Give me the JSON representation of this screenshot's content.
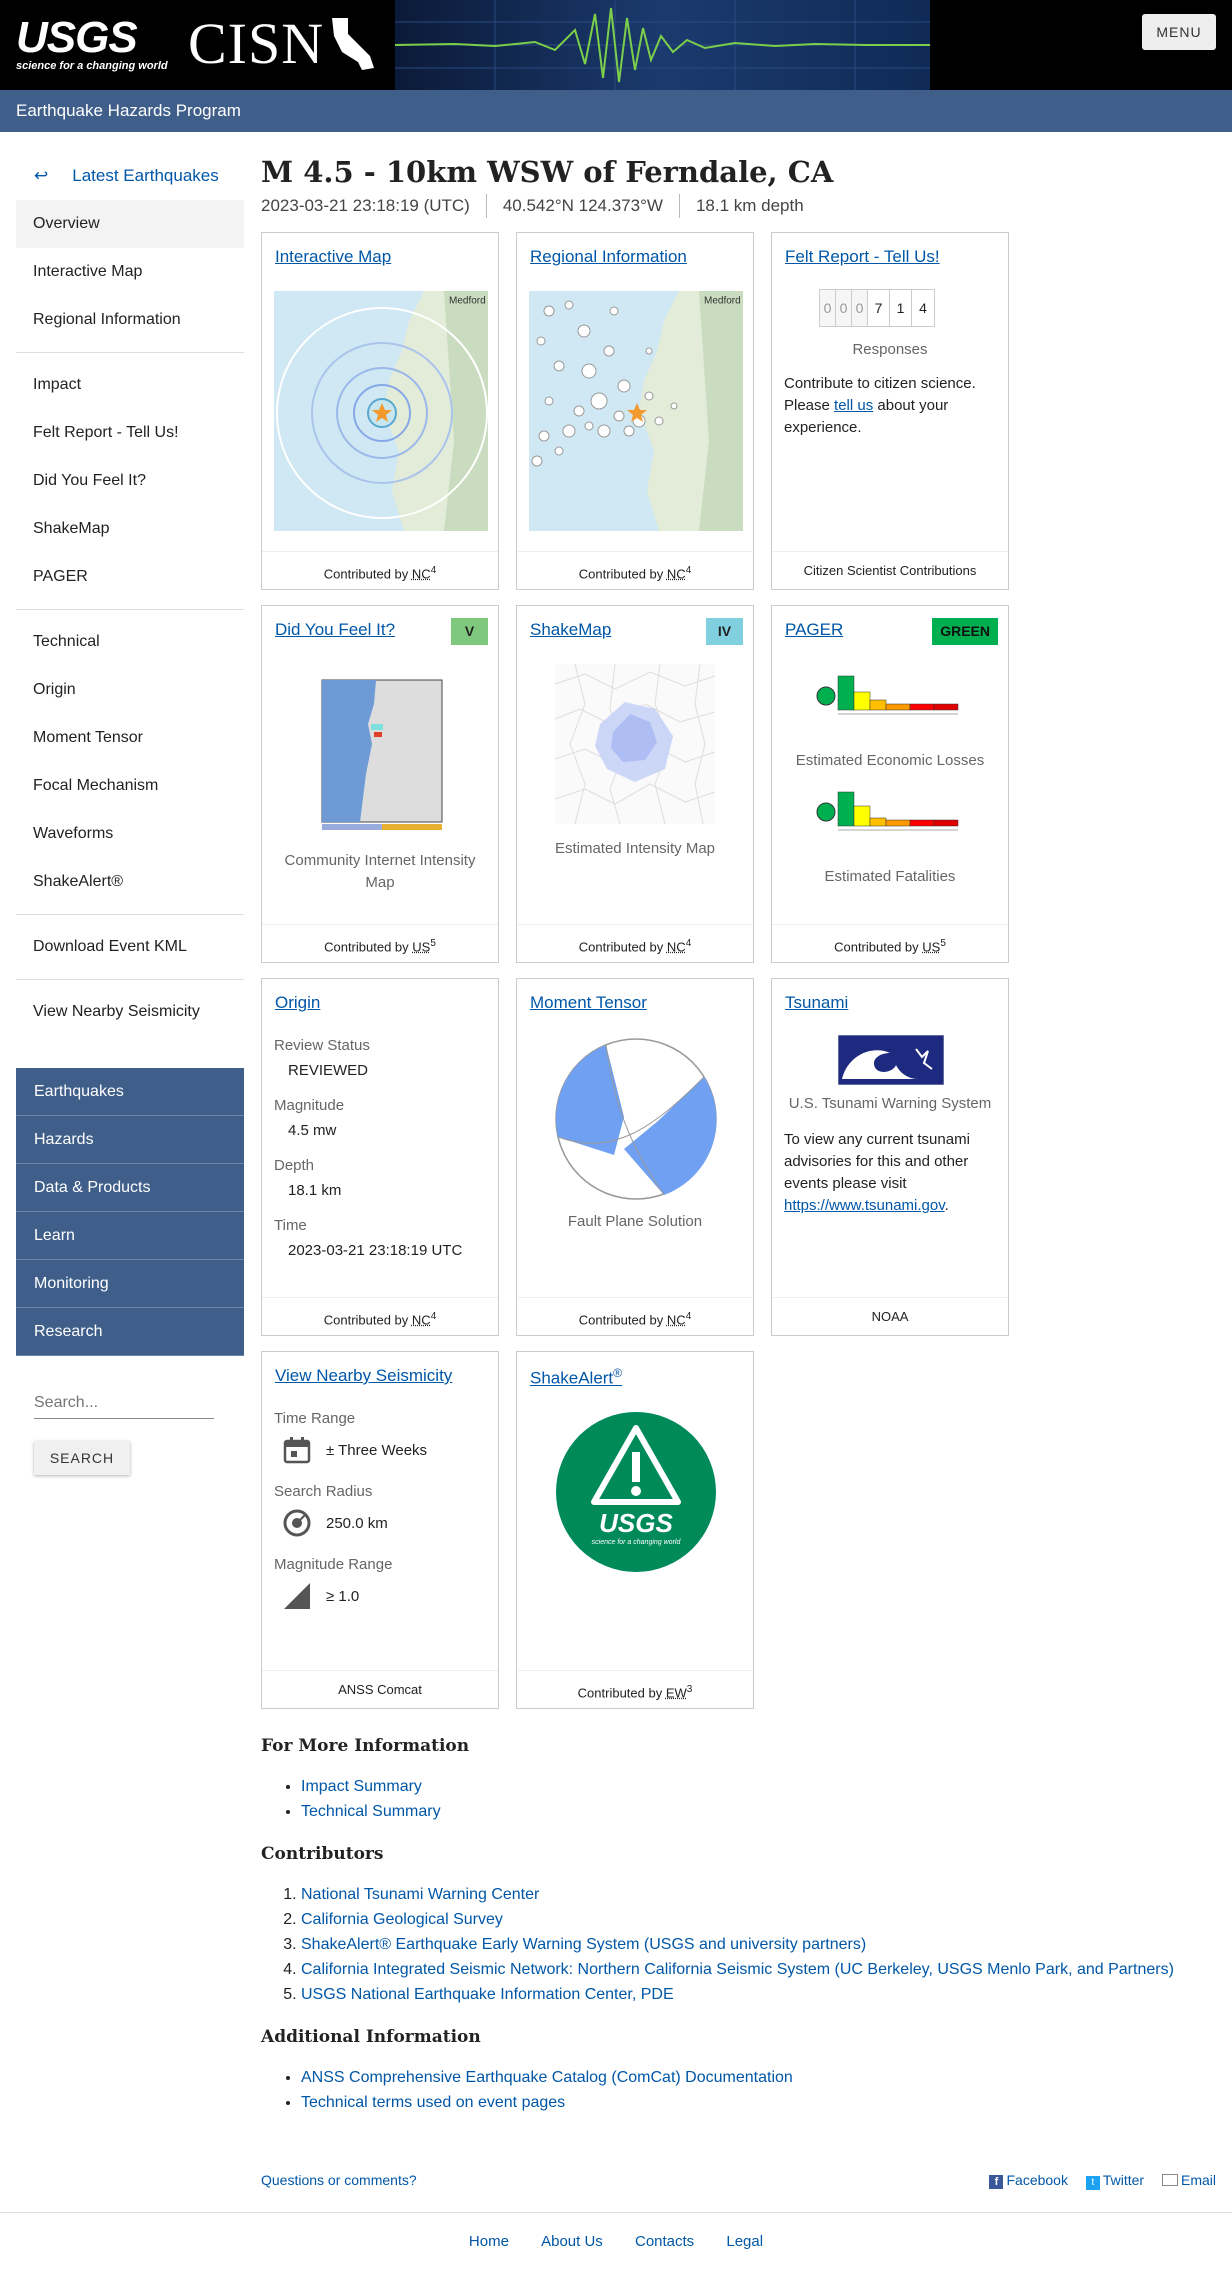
{
  "header": {
    "usgs_logo": "USGS",
    "usgs_tagline": "science for a changing world",
    "cisn_logo": "CISN",
    "menu_label": "MENU"
  },
  "navbar": {
    "title": "Earthquake Hazards Program"
  },
  "sidebar": {
    "back_label": "Latest Earthquakes",
    "group1": [
      "Overview",
      "Interactive Map",
      "Regional Information"
    ],
    "group2": [
      "Impact",
      "Felt Report - Tell Us!",
      "Did You Feel It?",
      "ShakeMap",
      "PAGER"
    ],
    "group3": [
      "Technical",
      "Origin",
      "Moment Tensor",
      "Focal Mechanism",
      "Waveforms",
      "ShakeAlert®"
    ],
    "group4": [
      "Download Event KML"
    ],
    "group5": [
      "View Nearby Seismicity"
    ],
    "bluenav": [
      "Earthquakes",
      "Hazards",
      "Data & Products",
      "Learn",
      "Monitoring",
      "Research"
    ],
    "search_placeholder": "Search...",
    "search_button": "SEARCH"
  },
  "event": {
    "title": "M 4.5 - 10km WSW of Ferndale, CA",
    "time": "2023-03-21 23:18:19 (UTC)",
    "location": "40.542°N 124.373°W",
    "depth": "18.1 km depth"
  },
  "cards": {
    "interactive_map": {
      "title": "Interactive Map",
      "map_label": "Medford",
      "footer_prefix": "Contributed by ",
      "source": "NC",
      "ref": "4"
    },
    "regional": {
      "title": "Regional Information",
      "map_label": "Medford",
      "footer_prefix": "Contributed by ",
      "source": "NC",
      "ref": "4"
    },
    "felt": {
      "title": "Felt Report - Tell Us!",
      "digits": [
        "0",
        "0",
        "0",
        "7",
        "1",
        "4"
      ],
      "responses": "Responses",
      "text_before": "Contribute to citizen science. Please ",
      "link": "tell us",
      "text_after": " about your experience.",
      "footer": "Citizen Scientist Contributions"
    },
    "dyfi": {
      "title": "Did You Feel It?",
      "badge": "V",
      "badge_color": "#7fc97f",
      "caption": "Community Internet Intensity Map",
      "footer_prefix": "Contributed by ",
      "source": "US",
      "ref": "5"
    },
    "shakemap": {
      "title": "ShakeMap",
      "badge": "IV",
      "badge_color": "#80d0e0",
      "caption": "Estimated Intensity Map",
      "footer_prefix": "Contributed by ",
      "source": "NC",
      "ref": "4"
    },
    "pager": {
      "title": "PAGER",
      "badge": "GREEN",
      "badge_color": "#00b050",
      "caption_losses": "Estimated Economic Losses",
      "caption_fatalities": "Estimated Fatalities",
      "footer_prefix": "Contributed by ",
      "source": "US",
      "ref": "5"
    },
    "origin": {
      "title": "Origin",
      "review_label": "Review Status",
      "review": "REVIEWED",
      "mag_label": "Magnitude",
      "mag": "4.5 mw",
      "depth_label": "Depth",
      "depth": "18.1 km",
      "time_label": "Time",
      "time": "2023-03-21 23:18:19 UTC",
      "footer_prefix": "Contributed by ",
      "source": "NC",
      "ref": "4"
    },
    "moment": {
      "title": "Moment Tensor",
      "caption": "Fault Plane Solution",
      "footer_prefix": "Contributed by ",
      "source": "NC",
      "ref": "4"
    },
    "tsunami": {
      "title": "Tsunami",
      "caption": "U.S. Tsunami Warning System",
      "text": "To view any current tsunami advisories for this and other events please visit ",
      "link": "https://www.tsunami.gov",
      "text_after": ".",
      "footer": "NOAA"
    },
    "nearby": {
      "title": "View Nearby Seismicity",
      "range_label": "Time Range",
      "range": "± Three Weeks",
      "radius_label": "Search Radius",
      "radius": "250.0 km",
      "mag_label": "Magnitude Range",
      "mag": "≥ 1.0",
      "footer": "ANSS Comcat"
    },
    "shakealert": {
      "title": "ShakeAlert",
      "reg": "®",
      "logo": "USGS",
      "logo_tag": "science for a changing world",
      "footer_prefix": "Contributed by ",
      "source": "EW",
      "ref": "3"
    }
  },
  "more_info": {
    "heading": "For More Information",
    "items": [
      "Impact Summary",
      "Technical Summary"
    ]
  },
  "contributors": {
    "heading": "Contributors",
    "items": [
      "National Tsunami Warning Center",
      "California Geological Survey",
      "ShakeAlert® Earthquake Early Warning System (USGS and university partners)",
      "California Integrated Seismic Network: Northern California Seismic System (UC Berkeley, USGS Menlo Park, and Partners)",
      "USGS National Earthquake Information Center, PDE"
    ]
  },
  "additional": {
    "heading": "Additional Information",
    "items": [
      "ANSS Comprehensive Earthquake Catalog (ComCat) Documentation",
      "Technical terms used on event pages"
    ]
  },
  "questions": "Questions or comments?",
  "social": [
    "Facebook",
    "Twitter",
    "Email"
  ],
  "footer": [
    "Home",
    "About Us",
    "Contacts",
    "Legal"
  ]
}
